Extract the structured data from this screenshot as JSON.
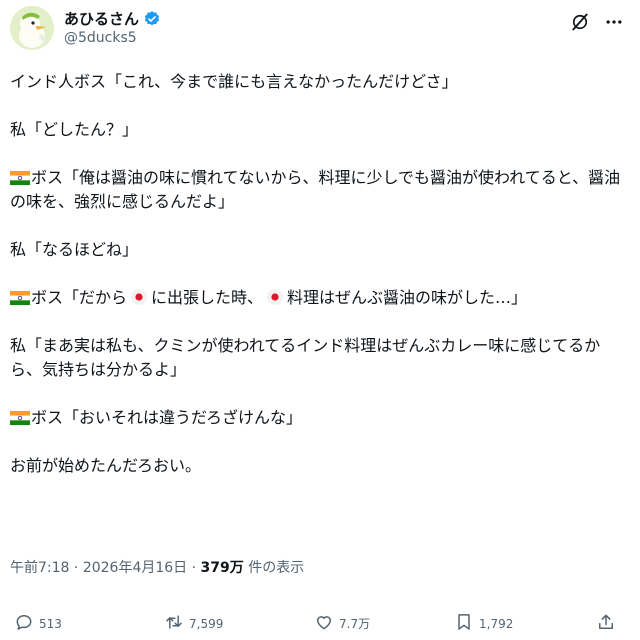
{
  "author": {
    "display_name": "あひるさん",
    "handle": "@5ducks5",
    "verified_color": "#1d9bf0"
  },
  "post": {
    "paragraphs": [
      {
        "prefix_flag": "",
        "segments": [
          "インド人ボス「これ、今まで誰にも言えなかったんだけどさ」"
        ]
      },
      {
        "prefix_flag": "",
        "segments": [
          "私「どしたん？」"
        ]
      },
      {
        "prefix_flag": "india-flag",
        "segments": [
          "ボス「俺は醤油の味に慣れてないから、料理に少しでも醤油が使われてると、醤油の味を、強烈に感じるんだよ」"
        ]
      },
      {
        "prefix_flag": "",
        "segments": [
          "私「なるほどね」"
        ]
      },
      {
        "prefix_flag": "india-flag",
        "segments": [
          "ボス「だから",
          "に出張した時、",
          "料理はぜんぶ醤油の味がした…」"
        ],
        "inline_flag": "japan-flag"
      },
      {
        "prefix_flag": "",
        "segments": [
          "私「まあ実は私も、クミンが使われてるインド料理はぜんぶカレー味に感じてるから、気持ちは分かるよ」"
        ]
      },
      {
        "prefix_flag": "india-flag",
        "segments": [
          "ボス「おいそれは違うだろざけんな」"
        ]
      },
      {
        "prefix_flag": "",
        "segments": [
          "お前が始めたんだろおい。"
        ]
      }
    ]
  },
  "meta": {
    "time": "午前7:18",
    "separator": "·",
    "date": "2026年4月16日",
    "views_count": "379万",
    "views_label": "件の表示"
  },
  "actions": {
    "reply": {
      "icon": "reply-icon",
      "count": "513"
    },
    "repost": {
      "icon": "repost-icon",
      "count": "7,599"
    },
    "like": {
      "icon": "like-icon",
      "count": "7.7万"
    },
    "bookmark": {
      "icon": "bookmark-icon",
      "count": "1,792"
    },
    "share": {
      "icon": "share-icon",
      "count": ""
    }
  }
}
